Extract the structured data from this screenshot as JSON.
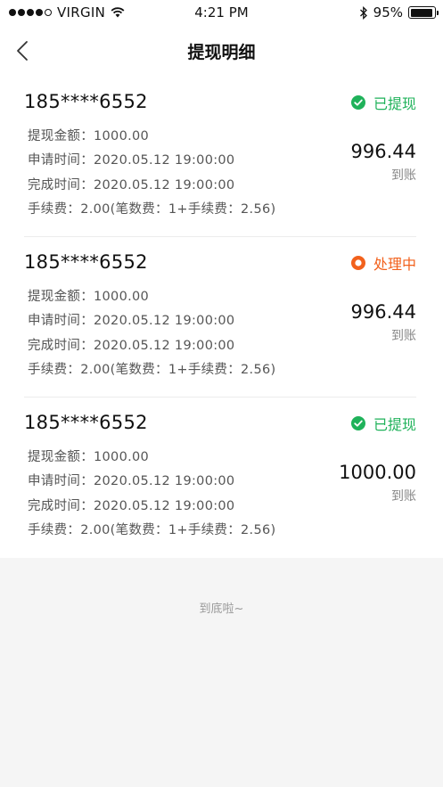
{
  "status_bar": {
    "carrier": "VIRGIN",
    "time": "4:21 PM",
    "battery": "95%",
    "battery_level": 0.95,
    "signal_bars": 4
  },
  "nav": {
    "title": "提现明细",
    "back_icon": "chevron-left-icon"
  },
  "colors": {
    "done": "#1fb25a",
    "processing": "#f2611c"
  },
  "records": [
    {
      "phone": "185****6552",
      "status": "已提现",
      "status_type": "done",
      "amount_line": "提现金额：1000.00",
      "apply_line": "申请时间：2020.05.12   19:00:00",
      "complete_line": "完成时间：2020.05.12   19:00:00",
      "fee_line": "手续费：2.00(笔数费：1+手续费：2.56)",
      "received": "996.44",
      "received_label": "到账"
    },
    {
      "phone": "185****6552",
      "status": "处理中",
      "status_type": "processing",
      "amount_line": "提现金额：1000.00",
      "apply_line": "申请时间：2020.05.12   19:00:00",
      "complete_line": "完成时间：2020.05.12   19:00:00",
      "fee_line": "手续费：2.00(笔数费：1+手续费：2.56)",
      "received": "996.44",
      "received_label": "到账"
    },
    {
      "phone": "185****6552",
      "status": "已提现",
      "status_type": "done",
      "amount_line": "提现金额：1000.00",
      "apply_line": "申请时间：2020.05.12   19:00:00",
      "complete_line": "完成时间：2020.05.12   19:00:00",
      "fee_line": "手续费：2.00(笔数费：1+手续费：2.56)",
      "received": "1000.00",
      "received_label": "到账"
    }
  ],
  "footer": {
    "end_text": "到底啦~"
  }
}
